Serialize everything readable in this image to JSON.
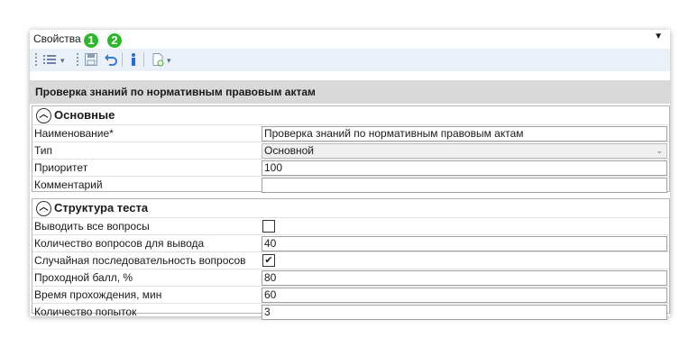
{
  "window": {
    "title": "Свойства",
    "dropdown_glyph": "▼"
  },
  "badges": [
    "1",
    "2"
  ],
  "toolbar": {
    "icons": [
      "list-icon",
      "save-icon",
      "undo-icon",
      "info-icon",
      "document-icon"
    ]
  },
  "caption": "Проверка знаний по нормативным правовым актам",
  "groups": [
    {
      "title": "Основные",
      "rows": [
        {
          "label": "Наименование*",
          "value": "Проверка знаний по нормативным правовым актам"
        },
        {
          "label": "Тип",
          "value": "Основной"
        },
        {
          "label": "Приоритет",
          "value": "100"
        },
        {
          "label": "Комментарий",
          "value": ""
        }
      ]
    },
    {
      "title": "Структура теста",
      "rows": [
        {
          "label": "Выводить все вопросы",
          "value": ""
        },
        {
          "label": "Количество вопросов для вывода",
          "value": "40"
        },
        {
          "label": "Случайная последовательность вопросов",
          "value": "✔"
        },
        {
          "label": "Проходной балл, %",
          "value": "80"
        },
        {
          "label": "Время прохождения, мин",
          "value": "60"
        },
        {
          "label": "Количество попыток",
          "value": "3"
        }
      ]
    }
  ],
  "colors": {
    "badge": "#2db52d",
    "toolbar_bg": "#e9f0f8",
    "caption_bg": "#d9d9d9"
  }
}
